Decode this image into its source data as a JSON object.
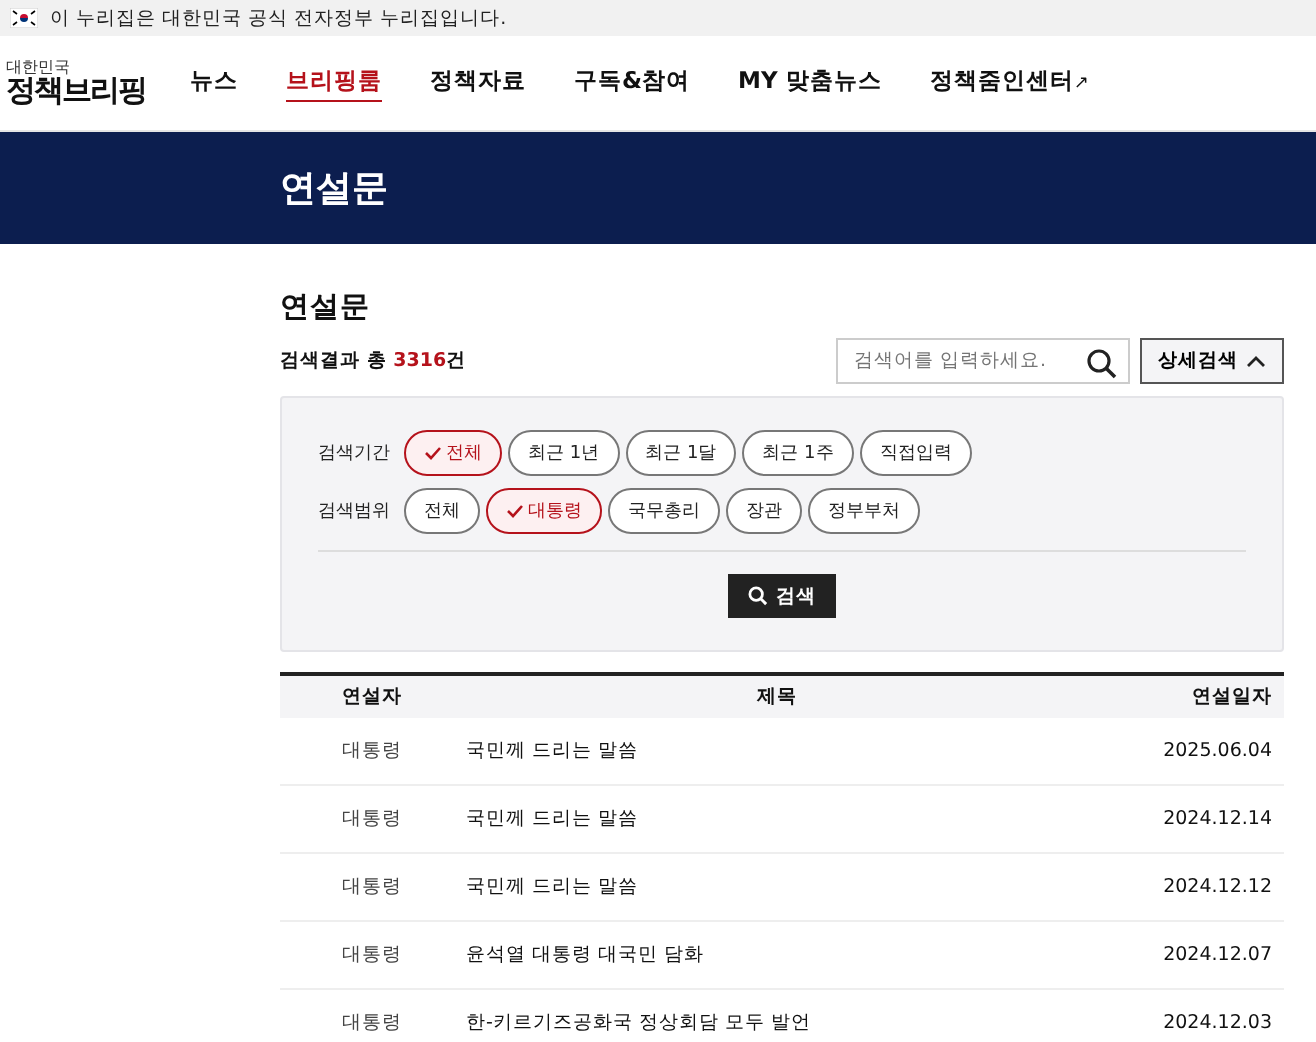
{
  "gov_banner": {
    "text": "이 누리집은 대한민국 공식 전자정부 누리집입니다."
  },
  "logo": {
    "small": "대한민국",
    "main": "정책브리핑"
  },
  "nav": [
    {
      "label": "뉴스",
      "selected": false
    },
    {
      "label": "브리핑룸",
      "selected": true
    },
    {
      "label": "정책자료",
      "selected": false
    },
    {
      "label": "구독&참여",
      "selected": false
    },
    {
      "label": "MY 맞춤뉴스",
      "selected": false
    },
    {
      "label": "정책줌인센터",
      "selected": false,
      "external": "↗"
    }
  ],
  "page_banner": {
    "title": "연설문"
  },
  "section_title": "연설문",
  "result": {
    "prefix": "검색결과 총 ",
    "count": "3316",
    "suffix": "건"
  },
  "search": {
    "placeholder": "검색어를 입력하세요.",
    "detail_button": "상세검색",
    "detail_expanded": true
  },
  "filters": [
    {
      "label": "검색기간",
      "options": [
        {
          "label": "전체",
          "selected": true
        },
        {
          "label": "최근 1년",
          "selected": false
        },
        {
          "label": "최근 1달",
          "selected": false
        },
        {
          "label": "최근 1주",
          "selected": false
        },
        {
          "label": "직접입력",
          "selected": false
        }
      ]
    },
    {
      "label": "검색범위",
      "options": [
        {
          "label": "전체",
          "selected": false
        },
        {
          "label": "대통령",
          "selected": true
        },
        {
          "label": "국무총리",
          "selected": false
        },
        {
          "label": "장관",
          "selected": false
        },
        {
          "label": "정부부처",
          "selected": false
        }
      ]
    }
  ],
  "search_button": "검색",
  "table": {
    "columns": [
      "연설자",
      "제목",
      "연설일자"
    ],
    "rows": [
      {
        "speaker": "대통령",
        "title": "국민께 드리는 말씀",
        "date": "2025.06.04"
      },
      {
        "speaker": "대통령",
        "title": "국민께 드리는 말씀",
        "date": "2024.12.14"
      },
      {
        "speaker": "대통령",
        "title": "국민께 드리는 말씀",
        "date": "2024.12.12"
      },
      {
        "speaker": "대통령",
        "title": "윤석열 대통령 대국민 담화",
        "date": "2024.12.07"
      },
      {
        "speaker": "대통령",
        "title": "한-키르기즈공화국 정상회담 모두 발언",
        "date": "2024.12.03"
      }
    ]
  }
}
